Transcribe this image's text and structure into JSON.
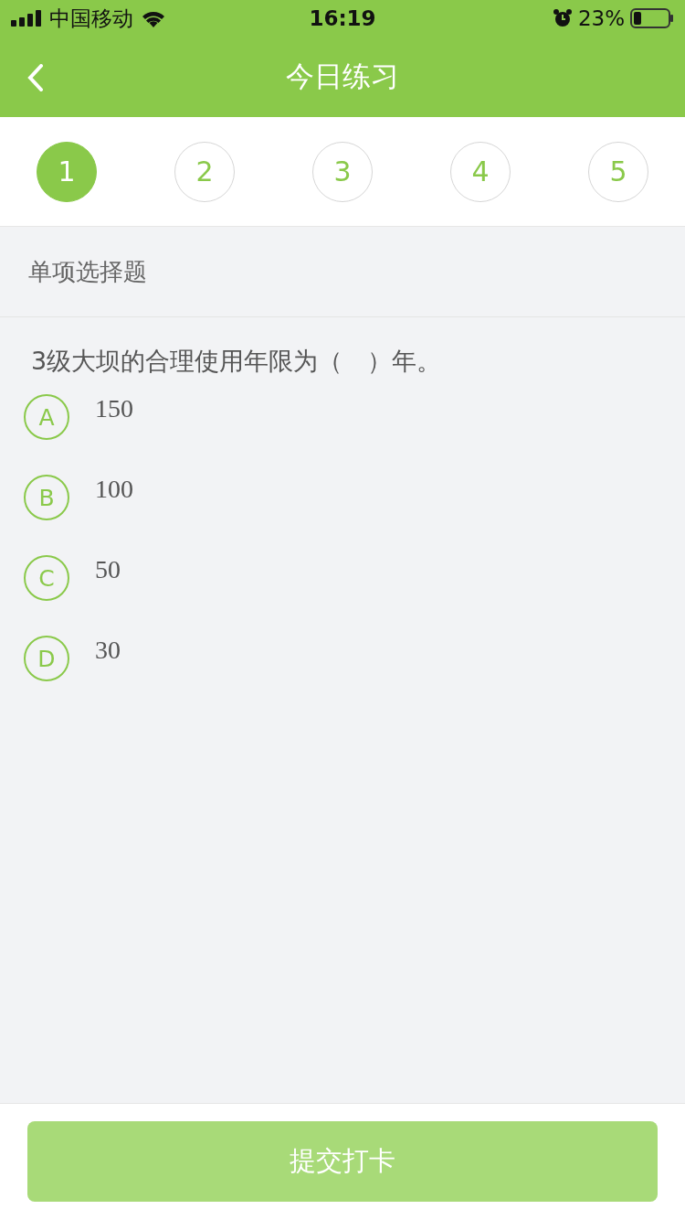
{
  "status_bar": {
    "carrier": "中国移动",
    "time": "16:19",
    "battery": "23%"
  },
  "nav": {
    "title": "今日练习"
  },
  "steps": [
    {
      "label": "1",
      "selected": true
    },
    {
      "label": "2",
      "selected": false
    },
    {
      "label": "3",
      "selected": false
    },
    {
      "label": "4",
      "selected": false
    },
    {
      "label": "5",
      "selected": false
    }
  ],
  "section": {
    "title": "单项选择题"
  },
  "question": {
    "text": "3级大坝的合理使用年限为（　）年。"
  },
  "options": [
    {
      "letter": "A",
      "text": "150",
      "selected": false
    },
    {
      "letter": "B",
      "text": "100",
      "selected": false
    },
    {
      "letter": "C",
      "text": "50",
      "selected": false
    },
    {
      "letter": "D",
      "text": "30",
      "selected": false
    }
  ],
  "submit": {
    "label": "提交打卡",
    "disabled": true
  }
}
